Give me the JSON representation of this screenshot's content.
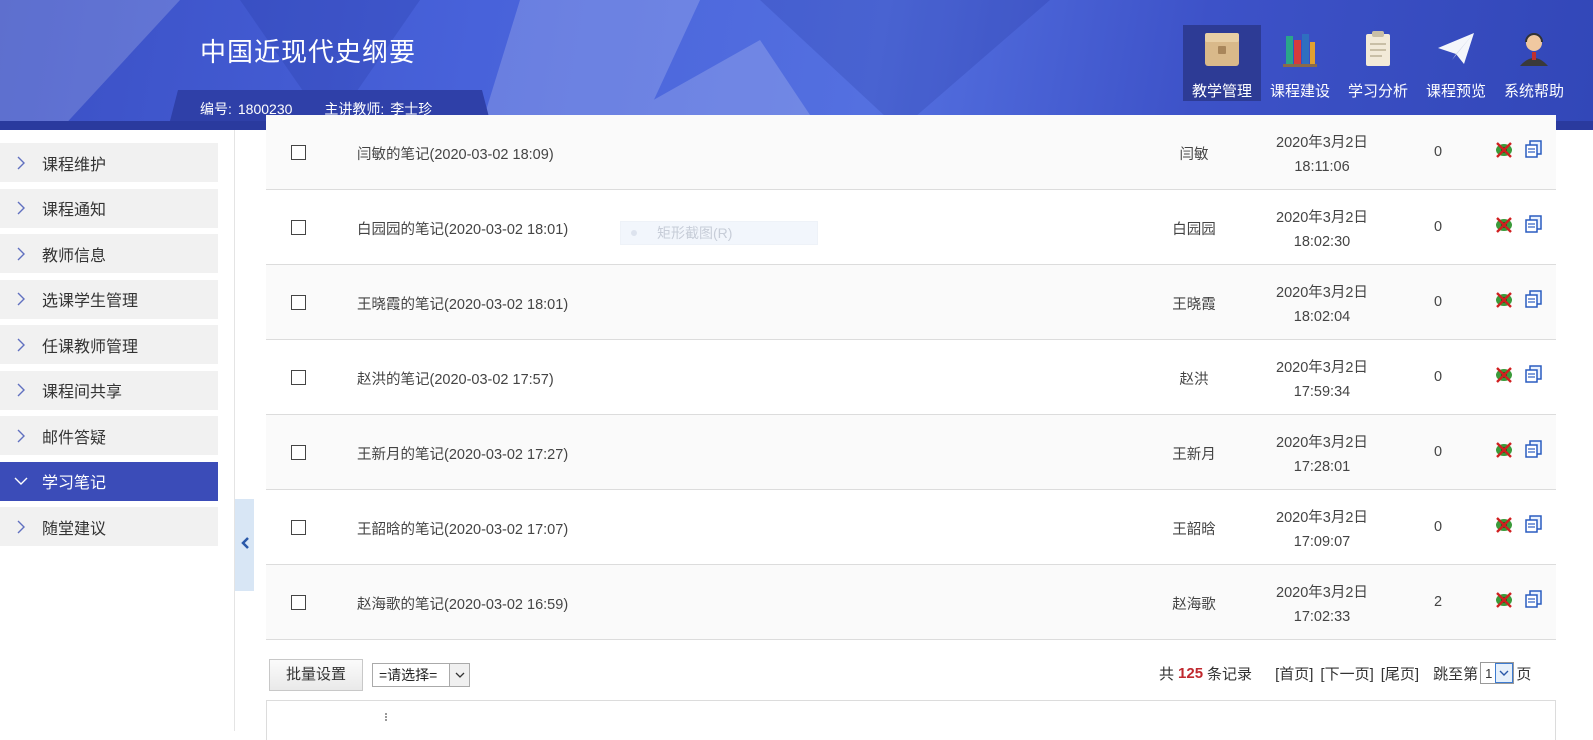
{
  "header": {
    "course_title": "中国近现代史纲要",
    "id_label": "编号:",
    "id_value": "1800230",
    "teacher_label": "主讲教师:",
    "teacher_value": "李士珍",
    "nav": [
      {
        "label": "教学管理",
        "icon": "box-icon",
        "active": true
      },
      {
        "label": "课程建设",
        "icon": "books-icon",
        "active": false
      },
      {
        "label": "学习分析",
        "icon": "clipboard-icon",
        "active": false
      },
      {
        "label": "课程预览",
        "icon": "paper-plane-icon",
        "active": false
      },
      {
        "label": "系统帮助",
        "icon": "support-agent-icon",
        "active": false
      }
    ]
  },
  "sidebar": {
    "items": [
      {
        "label": "课程维护",
        "active": false
      },
      {
        "label": "课程通知",
        "active": false
      },
      {
        "label": "教师信息",
        "active": false
      },
      {
        "label": "选课学生管理",
        "active": false
      },
      {
        "label": "任课教师管理",
        "active": false
      },
      {
        "label": "课程间共享",
        "active": false
      },
      {
        "label": "邮件答疑",
        "active": false
      },
      {
        "label": "学习笔记",
        "active": true
      },
      {
        "label": "随堂建议",
        "active": false
      }
    ]
  },
  "notes": {
    "rows": [
      {
        "title": "闫敏的笔记(2020-03-02 18:09)",
        "author": "闫敏",
        "date": "2020年3月2日",
        "time": "18:11:06",
        "count": "0"
      },
      {
        "title": "白园园的笔记(2020-03-02 18:01)",
        "author": "白园园",
        "date": "2020年3月2日",
        "time": "18:02:30",
        "count": "0"
      },
      {
        "title": "王晓霞的笔记(2020-03-02 18:01)",
        "author": "王晓霞",
        "date": "2020年3月2日",
        "time": "18:02:04",
        "count": "0"
      },
      {
        "title": "赵洪的笔记(2020-03-02 17:57)",
        "author": "赵洪",
        "date": "2020年3月2日",
        "time": "17:59:34",
        "count": "0"
      },
      {
        "title": "王新月的笔记(2020-03-02 17:27)",
        "author": "王新月",
        "date": "2020年3月2日",
        "time": "17:28:01",
        "count": "0"
      },
      {
        "title": "王韶晗的笔记(2020-03-02 17:07)",
        "author": "王韶晗",
        "date": "2020年3月2日",
        "time": "17:09:07",
        "count": "0"
      },
      {
        "title": "赵海歌的笔记(2020-03-02 16:59)",
        "author": "赵海歌",
        "date": "2020年3月2日",
        "time": "17:02:33",
        "count": "2"
      }
    ]
  },
  "overlay": {
    "ghost_menu_text": "矩形截图(R)"
  },
  "toolbar": {
    "batch_label": "批量设置",
    "select_value": "=请选择="
  },
  "pager": {
    "total_prefix": "共",
    "total_count": "125",
    "total_suffix": "条记录",
    "first": "[首页]",
    "next": "[下一页]",
    "last": "[尾页]",
    "jump_prefix": "跳至第",
    "page_value": "1",
    "jump_suffix": "页"
  },
  "colors": {
    "header_blue": "#4862da",
    "active_menu": "#3b4cb8",
    "count_red": "#c0282e"
  }
}
